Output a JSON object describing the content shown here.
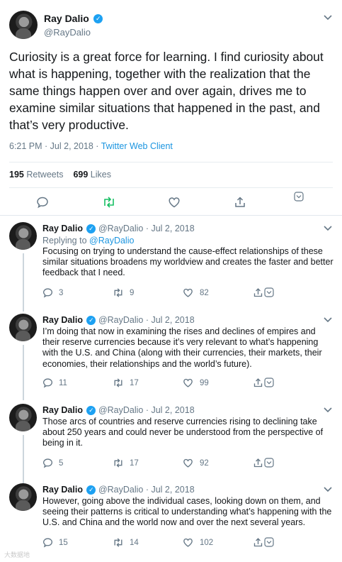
{
  "main_tweet": {
    "author_name": "Ray Dalio",
    "author_handle": "@RayDalio",
    "verified_icon": "verified-badge-icon",
    "text": "Curiosity is a great force for learning. I find curiosity about what is happening, together with the realization that the same things happen over and over again, drives me to examine similar situations that happened in the past, and that’s very productive.",
    "timestamp": "6:21 PM · Jul 2, 2018",
    "separator": " · ",
    "client": "Twitter Web Client",
    "retweets_count": "195",
    "retweets_label": "Retweets",
    "likes_count": "699",
    "likes_label": "Likes",
    "accent_color": "#1da1f2",
    "retweet_active_color": "#17bf63"
  },
  "replies": [
    {
      "name": "Ray Dalio",
      "handle": "@RayDalio",
      "date": "Jul 2, 2018",
      "replying_prefix": "Replying to",
      "replying_handle": "@RayDalio",
      "text": "Focusing on trying to understand the cause-effect relationships of these similar situations broadens my worldview and creates the faster and better feedback that I need.",
      "replies": "3",
      "retweets": "9",
      "likes": "82"
    },
    {
      "name": "Ray Dalio",
      "handle": "@RayDalio",
      "date": "Jul 2, 2018",
      "text": "I’m doing that now in examining the rises and declines of empires and their reserve currencies because it’s very relevant to what’s happening with the U.S. and China (along with their currencies, their markets, their economies, their relationships and the world’s future).",
      "replies": "11",
      "retweets": "17",
      "likes": "99"
    },
    {
      "name": "Ray Dalio",
      "handle": "@RayDalio",
      "date": "Jul 2, 2018",
      "text": "Those arcs of countries and reserve currencies rising to declining take about 250 years and could never be understood from the perspective of being in it.",
      "replies": "5",
      "retweets": "17",
      "likes": "92"
    },
    {
      "name": "Ray Dalio",
      "handle": "@RayDalio",
      "date": "Jul 2, 2018",
      "text": "However, going above the individual cases, looking down on them, and seeing their patterns is critical to understanding what’s happening with the U.S. and China and the world now and over the next several years.",
      "replies": "15",
      "retweets": "14",
      "likes": "102"
    }
  ],
  "glyphs": {
    "verified": "✓",
    "chevron": "⌄",
    "dot": "·"
  },
  "watermark": "大数据地"
}
